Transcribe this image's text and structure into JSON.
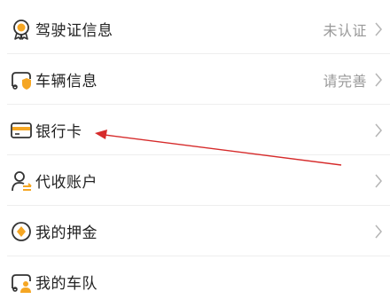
{
  "rows": [
    {
      "label": "驾驶证信息",
      "value": "未认证",
      "icon": "license-badge-icon"
    },
    {
      "label": "车辆信息",
      "value": "请完善",
      "icon": "vehicle-shield-icon"
    },
    {
      "label": "银行卡",
      "value": "",
      "icon": "bank-card-icon"
    },
    {
      "label": "代收账户",
      "value": "",
      "icon": "collection-account-icon"
    },
    {
      "label": "我的押金",
      "value": "",
      "icon": "deposit-icon"
    },
    {
      "label": "我的车队",
      "value": "",
      "icon": "fleet-icon"
    }
  ],
  "colors": {
    "accent": "#f5a623",
    "annotation": "#d62b2b",
    "text": "#222222",
    "secondary": "#999999"
  }
}
